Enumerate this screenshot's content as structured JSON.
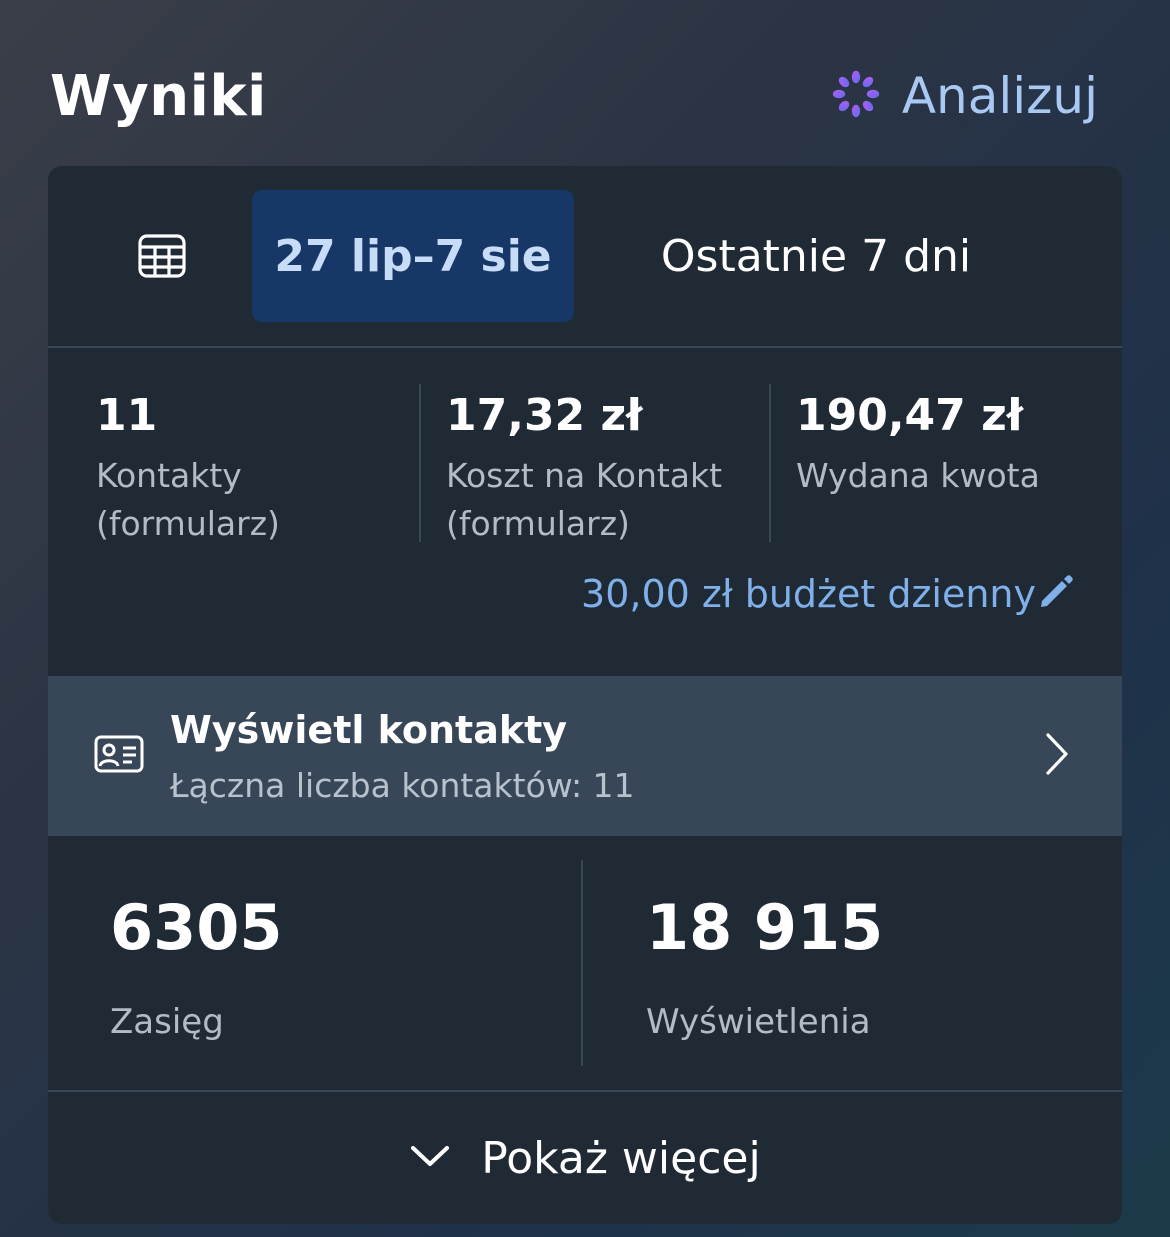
{
  "header": {
    "title": "Wyniki",
    "analyze_label": "Analizuj"
  },
  "date_tabs": {
    "calendar_icon": "calendar-icon",
    "active_range": "27 lip–7 sie",
    "preset": "Ostatnie 7 dni"
  },
  "metrics": [
    {
      "value": "11",
      "label": "Kontakty (formularz)"
    },
    {
      "value": "17,32 zł",
      "label": "Koszt na Kontakt (formularz)"
    },
    {
      "value": "190,47 zł",
      "label": "Wydana kwota"
    }
  ],
  "budget": {
    "text": "30,00 zł budżet dzienny",
    "icon": "pencil-icon"
  },
  "contacts": {
    "title": "Wyświetl kontakty",
    "subtitle": "Łączna liczba kontaktów: 11",
    "icon": "contact-card-icon"
  },
  "stats": [
    {
      "value": "6305",
      "label": "Zasięg"
    },
    {
      "value": "18 915",
      "label": "Wyświetlenia"
    }
  ],
  "footer": {
    "show_more_label": "Pokaż więcej"
  },
  "colors": {
    "accent_link": "#7fb0ea",
    "active_tab_bg": "#173767",
    "active_tab_text": "#c7dcf7",
    "card_bg": "#1f2a35",
    "contacts_row_bg": "#384757"
  }
}
